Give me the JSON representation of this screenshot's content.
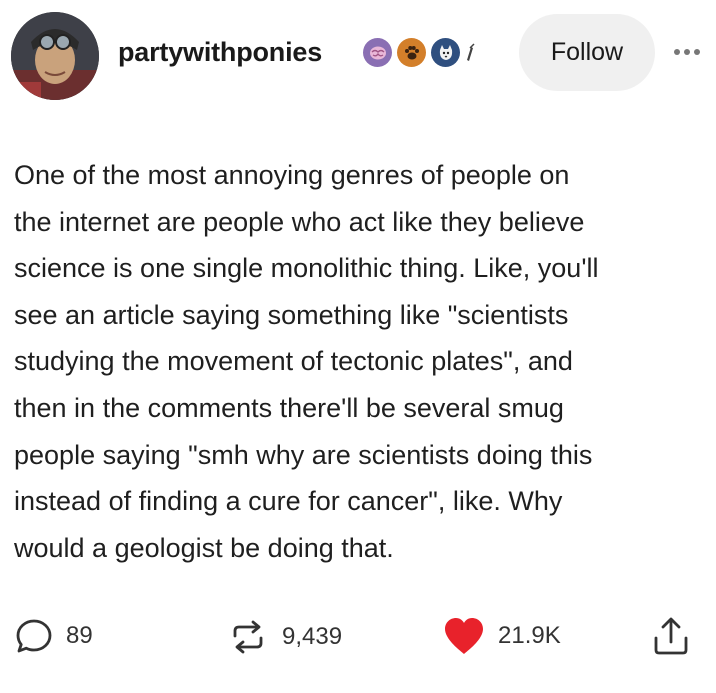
{
  "header": {
    "username": "partywithponies",
    "follow_label": "Follow",
    "badges": [
      "brain-badge",
      "paw-badge",
      "cat-badge",
      "partial-badge"
    ]
  },
  "post": {
    "lines": [
      "One of the most annoying genres of people on",
      "the internet are people who act like they believe",
      "science is one single monolithic thing. Like, you'll",
      "see an article saying something like \"scientists",
      "studying the movement of tectonic plates\", and",
      "then in the comments there'll be several smug",
      "people saying \"smh why are scientists doing this",
      "instead of finding a cure for cancer\", like. Why",
      "would a geologist be doing that."
    ]
  },
  "footer": {
    "replies": "89",
    "reblogs": "9,439",
    "likes": "21.9K"
  },
  "colors": {
    "like_heart": "#e8222b",
    "follow_bg": "#f0f0f0",
    "badge_purple": "#8a6fb3",
    "badge_orange": "#d37f2a",
    "badge_blue": "#2f4f7f"
  }
}
